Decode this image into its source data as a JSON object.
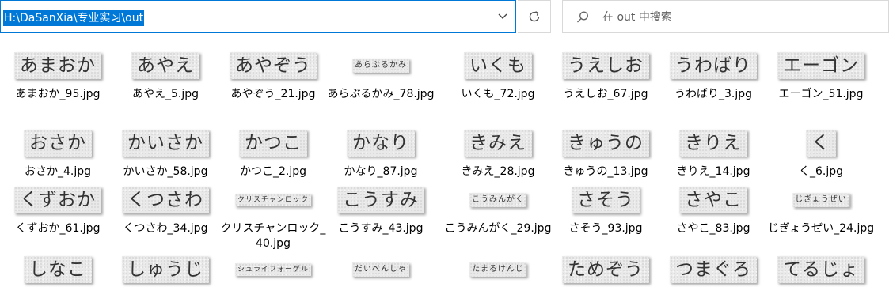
{
  "address_bar": {
    "path": "H:\\DaSanXia\\专业实习\\out"
  },
  "search": {
    "placeholder": "在 out 中搜索"
  },
  "files": [
    {
      "thumb": "あまおか",
      "name": "あまおか_95.jpg"
    },
    {
      "thumb": "あやえ",
      "name": "あやえ_5.jpg"
    },
    {
      "thumb": "あやぞう",
      "name": "あやぞう_21.jpg"
    },
    {
      "thumb": "あらぶるかみ",
      "name": "あらぶるかみ_78.jpg"
    },
    {
      "thumb": "いくも",
      "name": "いくも_72.jpg"
    },
    {
      "thumb": "うえしお",
      "name": "うえしお_67.jpg"
    },
    {
      "thumb": "うわばり",
      "name": "うわばり_3.jpg"
    },
    {
      "thumb": "エーゴン",
      "name": "エーゴン_51.jpg"
    },
    {
      "thumb": "おさか",
      "name": "おさか_4.jpg"
    },
    {
      "thumb": "かいさか",
      "name": "かいさか_58.jpg"
    },
    {
      "thumb": "かつこ",
      "name": "かつこ_2.jpg"
    },
    {
      "thumb": "かなり",
      "name": "かなり_87.jpg"
    },
    {
      "thumb": "きみえ",
      "name": "きみえ_28.jpg"
    },
    {
      "thumb": "きゅうの",
      "name": "きゅうの_13.jpg"
    },
    {
      "thumb": "きりえ",
      "name": "きりえ_14.jpg"
    },
    {
      "thumb": "く",
      "name": "く_6.jpg"
    },
    {
      "thumb": "くずおか",
      "name": "くずおか_61.jpg"
    },
    {
      "thumb": "くつさわ",
      "name": "くつさわ_34.jpg"
    },
    {
      "thumb": "クリスチャンロック",
      "name": "クリスチャンロック_40.jpg"
    },
    {
      "thumb": "こうすみ",
      "name": "こうすみ_43.jpg"
    },
    {
      "thumb": "こうみんがく",
      "name": "こうみんがく_29.jpg"
    },
    {
      "thumb": "さそう",
      "name": "さそう_93.jpg"
    },
    {
      "thumb": "さやこ",
      "name": "さやこ_83.jpg"
    },
    {
      "thumb": "じぎょうぜい",
      "name": "じぎょうぜい_24.jpg"
    },
    {
      "thumb": "しなこ",
      "name": ""
    },
    {
      "thumb": "しゅうじ",
      "name": ""
    },
    {
      "thumb": "シュライフォーゲル",
      "name": ""
    },
    {
      "thumb": "だいべんしゃ",
      "name": ""
    },
    {
      "thumb": "たまるけんじ",
      "name": ""
    },
    {
      "thumb": "ためぞう",
      "name": ""
    },
    {
      "thumb": "つまぐろ",
      "name": ""
    },
    {
      "thumb": "てるじょ",
      "name": ""
    }
  ]
}
